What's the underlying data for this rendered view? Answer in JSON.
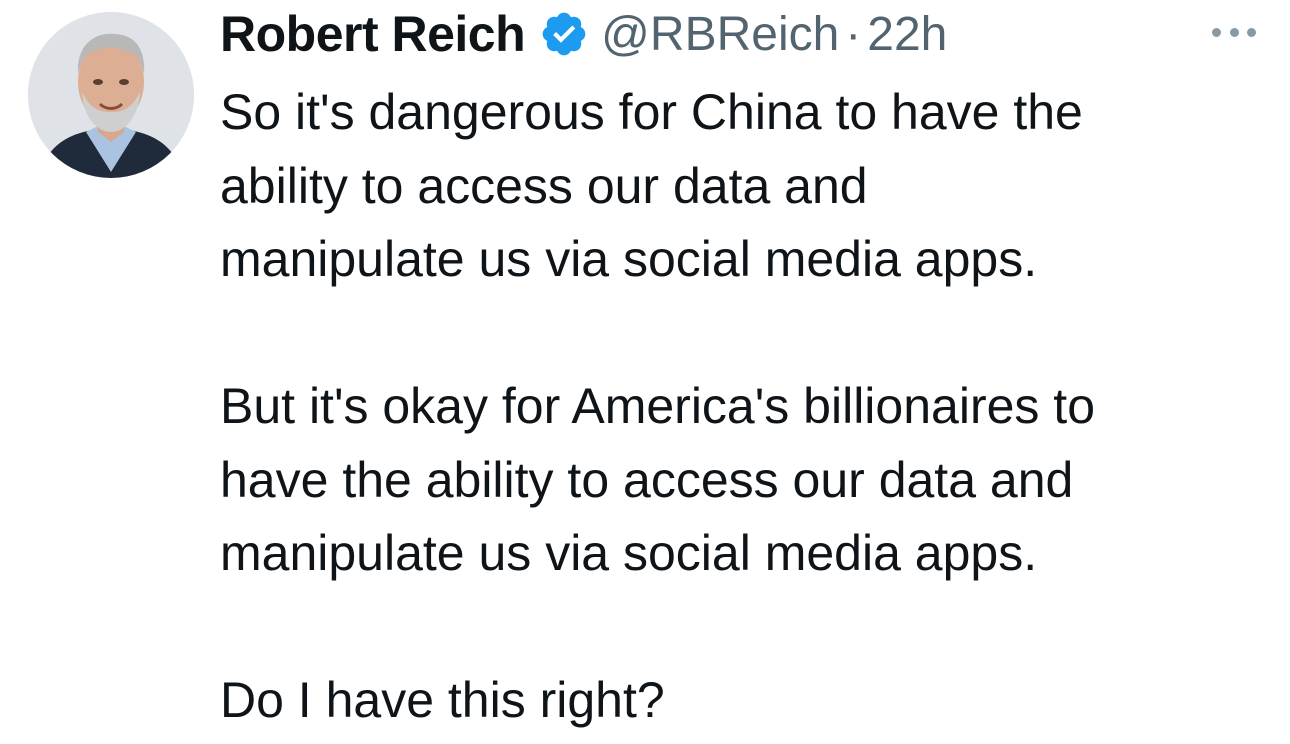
{
  "tweet": {
    "display_name": "Robert Reich",
    "verified": true,
    "handle": "@RBReich",
    "separator": "·",
    "timestamp": "22h",
    "more_icon": "more-horizontal-icon",
    "avatar_icon": "user-avatar-photo",
    "paragraphs": [
      {
        "lines": [
          "So it's dangerous for China to have the",
          "ability to access our data and",
          "manipulate us via social media apps."
        ]
      },
      {
        "lines": [
          "But it's okay for America's billionaires to",
          "have the ability to access our data and",
          "manipulate us via social media apps."
        ]
      },
      {
        "lines": [
          "Do I have this right?"
        ]
      }
    ]
  },
  "colors": {
    "text": "#0f1419",
    "secondary": "#536471",
    "verified_badge": "#1d9bf0",
    "background": "#ffffff"
  }
}
